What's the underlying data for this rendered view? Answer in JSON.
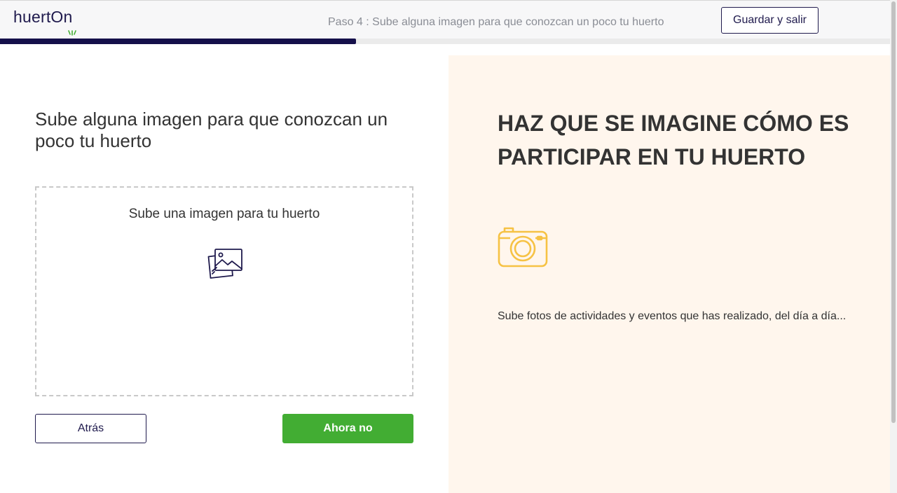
{
  "header": {
    "logo_text": "huertOn",
    "step_text": "Paso 4 : Sube alguna imagen para que conozcan un poco tu huerto",
    "save_label": "Guardar y salir"
  },
  "progress": {
    "fraction": 0.4
  },
  "left": {
    "title": "Sube alguna imagen para que conozcan un poco tu huerto",
    "upload_label": "Sube una imagen para tu huerto",
    "upload_icon": "images-icon",
    "back_label": "Atrás",
    "skip_label": "Ahora no"
  },
  "right": {
    "title": "HAZ QUE SE IMAGINE CÓMO ES PARTICIPAR EN TU HUERTO",
    "camera_icon": "camera-icon",
    "description": "Sube fotos de actividades y eventos que has realizado, del día a día..."
  },
  "colors": {
    "brand_dark": "#1f1a4d",
    "progress": "#15104a",
    "primary_green": "#42ad33",
    "panel_bg": "#fff6ed",
    "icon_yellow": "#f6c244"
  }
}
